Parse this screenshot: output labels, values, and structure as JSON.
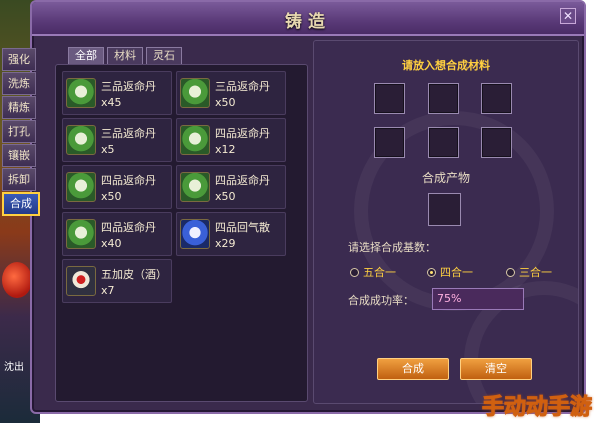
{
  "window": {
    "title": "铸造",
    "close_icon": "close-icon"
  },
  "side_tabs": [
    {
      "label": "强化",
      "active": false
    },
    {
      "label": "洗炼",
      "active": false
    },
    {
      "label": "精炼",
      "active": false
    },
    {
      "label": "打孔",
      "active": false
    },
    {
      "label": "镶嵌",
      "active": false
    },
    {
      "label": "拆卸",
      "active": false
    },
    {
      "label": "合成",
      "active": true
    }
  ],
  "category_tabs": [
    {
      "label": "全部",
      "active": true
    },
    {
      "label": "材料",
      "active": false
    },
    {
      "label": "灵石",
      "active": false
    }
  ],
  "items": [
    {
      "name": "三品返命丹",
      "qty": "x45",
      "icon": "green-pouch-icon"
    },
    {
      "name": "三品返命丹",
      "qty": "x50",
      "icon": "green-pouch-icon"
    },
    {
      "name": "三品返命丹",
      "qty": "x5",
      "icon": "green-pouch-icon"
    },
    {
      "name": "四品返命丹",
      "qty": "x12",
      "icon": "green-pouch-icon"
    },
    {
      "name": "四品返命丹",
      "qty": "x50",
      "icon": "green-pouch-icon"
    },
    {
      "name": "四品返命丹",
      "qty": "x50",
      "icon": "green-pouch-icon"
    },
    {
      "name": "四品返命丹",
      "qty": "x40",
      "icon": "green-pouch-icon"
    },
    {
      "name": "四品回气散",
      "qty": "x29",
      "icon": "blue-pouch-icon"
    },
    {
      "name": "五加皮（酒）",
      "qty": "x7",
      "icon": "wine-bottle-icon"
    }
  ],
  "synthesis": {
    "input_prompt": "请放入想合成材料",
    "output_label": "合成产物",
    "base_prompt": "请选择合成基数：",
    "options": [
      {
        "label": "五合一",
        "selected": false
      },
      {
        "label": "四合一",
        "selected": true
      },
      {
        "label": "三合一",
        "selected": false
      }
    ],
    "rate_label": "合成成功率：",
    "rate_value": "75%",
    "confirm_button": "合成",
    "clear_button": "清空"
  },
  "side_bottom_text": "沈出",
  "watermark": "手动动手游"
}
